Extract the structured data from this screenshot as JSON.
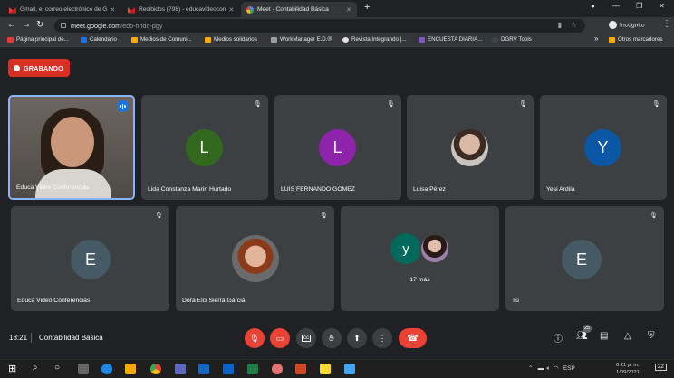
{
  "browser": {
    "tabs": [
      {
        "title": "Gmail, el correo electrónico de G",
        "icon": "gmail-icon"
      },
      {
        "title": "Recibidos (798) - educavideocon",
        "icon": "gmail-icon"
      },
      {
        "title": "Meet - Contabilidad Básica",
        "icon": "meet-icon"
      }
    ],
    "new_tab": "+",
    "url_host": "meet.google.com",
    "url_path": "/edo-hhdq-pgy",
    "incognito_label": "Incógnito",
    "bookmarks": [
      {
        "label": "Página principal de..."
      },
      {
        "label": "Calendario"
      },
      {
        "label": "Medios de Comuni..."
      },
      {
        "label": "Medios solidarios"
      },
      {
        "label": "WorkManager E.D.®"
      },
      {
        "label": "Revista Integrando |..."
      },
      {
        "label": "ENCUESTA DIARIA..."
      },
      {
        "label": "DGRV Tools"
      }
    ],
    "more_bookmarks": "»",
    "other_bookmarks": "Otros marcadores"
  },
  "meet": {
    "recording_label": "GRABANDO",
    "tiles": [
      {
        "name": "Educa Video Conferencias"
      },
      {
        "name": "Lida Constanza Marin Hurtado",
        "initial": "L",
        "color": "#33691e"
      },
      {
        "name": "LUIS FERNANDO GOMEZ",
        "initial": "L",
        "color": "#8e24aa"
      },
      {
        "name": "Luisa Pérez"
      },
      {
        "name": "Yesi Ardila",
        "initial": "Y",
        "color": "#0b57a6"
      },
      {
        "name": "Educa Video Conferencias",
        "initial": "E",
        "color": "#455a64"
      },
      {
        "name": "Dora Elci Sierra Garcia"
      },
      {
        "name": "",
        "initial": "y",
        "color": "#00695c",
        "more": "17 más"
      },
      {
        "name": "Tú",
        "initial": "E",
        "color": "#455a64"
      }
    ],
    "bottom": {
      "time": "18:21",
      "meeting_name": "Contabilidad Básica",
      "participants_count": "25"
    }
  },
  "taskbar": {
    "language": "ESP",
    "time": "6:21 p. m.",
    "date": "1/09/2021",
    "notifications": "22"
  }
}
